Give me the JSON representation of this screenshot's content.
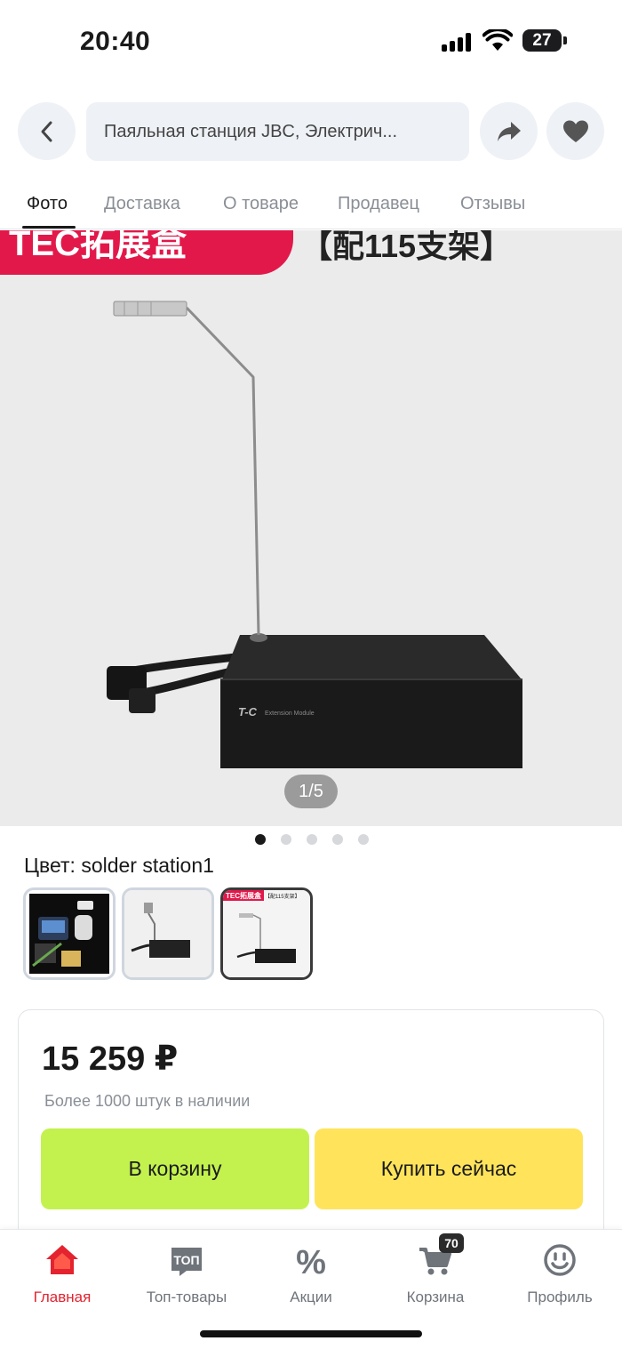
{
  "status_bar": {
    "time": "20:40",
    "battery": "27"
  },
  "top_nav": {
    "search_text": "Паяльная станция JBC, Электрич..."
  },
  "tabs": [
    {
      "label": "Фото"
    },
    {
      "label": "Доставка"
    },
    {
      "label": "О товаре"
    },
    {
      "label": "Продавец"
    },
    {
      "label": "Отзывы"
    }
  ],
  "product_image": {
    "banner_red_text": "TEC拓展盒",
    "banner_text": "【配115支架】",
    "brand_mark": "T-C",
    "device_text": "Extension Module",
    "counter": "1/5"
  },
  "gallery": {
    "dots_total": 5,
    "active_dot": 1
  },
  "color": {
    "label": "Цвет: solder station1",
    "thumb3_banner": "TEC拓展盒",
    "thumb3_text": "【配115支架】"
  },
  "purchase": {
    "price": "15 259 ₽",
    "stock": "Более 1000 штук в наличии",
    "add_to_cart": "В корзину",
    "buy_now": "Купить сейчас"
  },
  "bottom_nav": {
    "items": [
      {
        "label": "Главная",
        "icon": "home-icon"
      },
      {
        "label": "Топ-товары",
        "icon": "top-icon",
        "icon_text": "ТОП"
      },
      {
        "label": "Акции",
        "icon": "percent-icon",
        "icon_text": "%"
      },
      {
        "label": "Корзина",
        "icon": "cart-icon"
      },
      {
        "label": "Профиль",
        "icon": "smile-icon"
      }
    ],
    "cart_count": "70"
  },
  "colors": {
    "accent_red": "#e4232f",
    "cart_green": "#c3f24f",
    "buy_yellow": "#ffe45b",
    "banner_red": "#e2184a"
  }
}
